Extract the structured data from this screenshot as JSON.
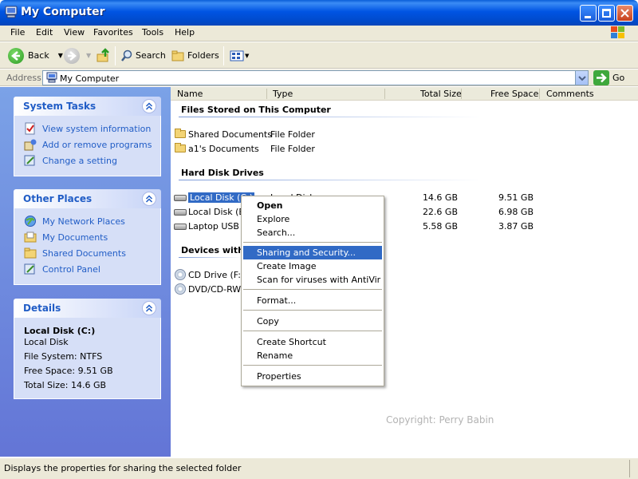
{
  "window": {
    "title": "My Computer"
  },
  "menubar": {
    "items": [
      "File",
      "Edit",
      "View",
      "Favorites",
      "Tools",
      "Help"
    ]
  },
  "toolbar": {
    "back_label": "Back",
    "search_label": "Search",
    "folders_label": "Folders"
  },
  "address": {
    "label": "Address",
    "value": "My Computer",
    "go_label": "Go"
  },
  "taskpane": {
    "system_tasks": {
      "title": "System Tasks",
      "items": [
        "View system information",
        "Add or remove programs",
        "Change a setting"
      ]
    },
    "other_places": {
      "title": "Other Places",
      "items": [
        "My Network Places",
        "My Documents",
        "Shared Documents",
        "Control Panel"
      ]
    },
    "details": {
      "title": "Details",
      "name": "Local Disk (C:)",
      "kind": "Local Disk",
      "file_system": "File System: NTFS",
      "free_space": "Free Space: 9.51 GB",
      "total_size": "Total Size: 14.6 GB"
    }
  },
  "columns": [
    "Name",
    "Type",
    "Total Size",
    "Free Space",
    "Comments"
  ],
  "groups": {
    "files_stored": {
      "title": "Files Stored on This Computer",
      "items": [
        {
          "name": "Shared Documents",
          "type": "File Folder"
        },
        {
          "name": "a1's Documents",
          "type": "File Folder"
        }
      ]
    },
    "hard_disks": {
      "title": "Hard Disk Drives",
      "items": [
        {
          "name": "Local Disk (C:)",
          "type": "Local Disk",
          "total": "14.6 GB",
          "free": "9.51 GB"
        },
        {
          "name": "Local Disk (E:)",
          "type": "",
          "total": "22.6 GB",
          "free": "6.98 GB"
        },
        {
          "name": "Laptop USB (H",
          "type": "",
          "total": "5.58 GB",
          "free": "3.87 GB"
        }
      ]
    },
    "removable": {
      "title": "Devices with",
      "items": [
        {
          "name": "CD Drive (F:)"
        },
        {
          "name": "DVD/CD-RW D"
        }
      ]
    }
  },
  "context_menu": {
    "items": [
      "Open",
      "Explore",
      "Search...",
      "Sharing and Security...",
      "Create Image",
      "Scan for viruses with AntiVir",
      "Format...",
      "Copy",
      "Create Shortcut",
      "Rename",
      "Properties"
    ]
  },
  "watermark": "Copyright: Perry Babin",
  "statusbar": {
    "text": "Displays the properties for sharing the selected folder"
  },
  "colors": {
    "title_blue": "#0054e3",
    "selection": "#316ac5",
    "task_link": "#215dc6"
  }
}
